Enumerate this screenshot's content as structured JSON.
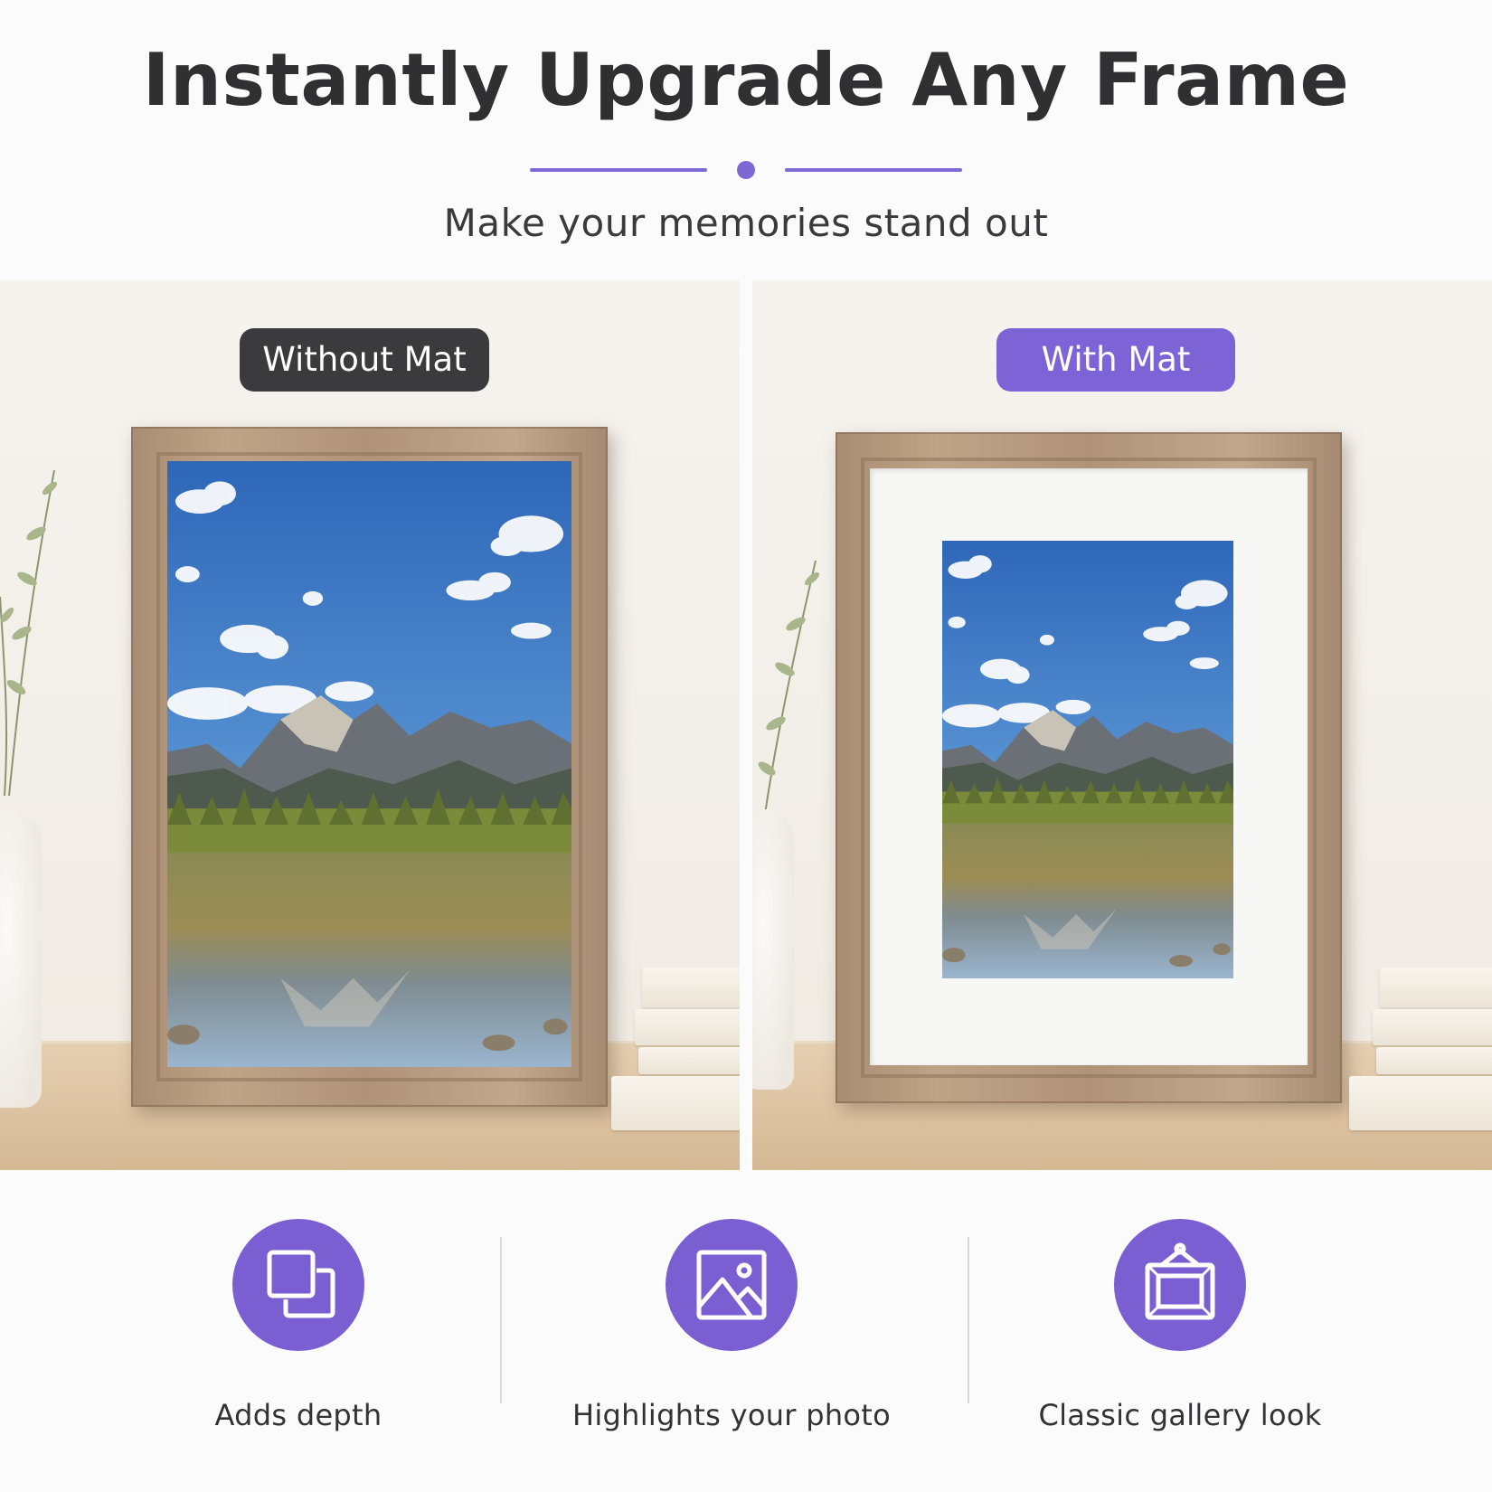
{
  "header": {
    "title": "Instantly Upgrade Any Frame",
    "subtitle": "Make your memories stand out",
    "accent_color": "#7d68d6"
  },
  "comparison": {
    "left_label": "Without Mat",
    "right_label": "With Mat"
  },
  "features": [
    {
      "label": "Adds depth",
      "icon": "layered-squares-icon"
    },
    {
      "label": "Highlights your photo",
      "icon": "image-icon"
    },
    {
      "label": "Classic gallery look",
      "icon": "hanging-frame-icon"
    }
  ]
}
